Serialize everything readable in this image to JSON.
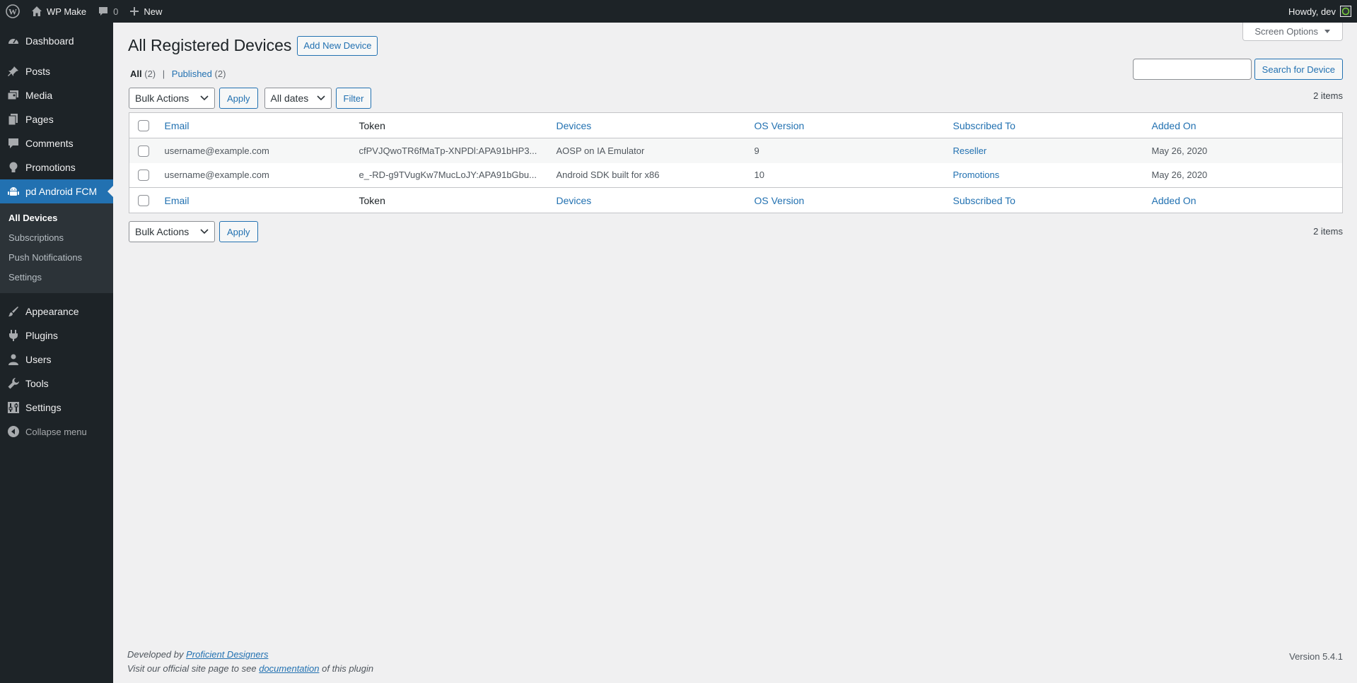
{
  "adminbar": {
    "site_name": "WP Make",
    "comments_count": "0",
    "new_label": "New",
    "howdy": "Howdy, dev"
  },
  "menu": {
    "dashboard": "Dashboard",
    "posts": "Posts",
    "media": "Media",
    "pages": "Pages",
    "comments": "Comments",
    "promotions": "Promotions",
    "pd_android_fcm": "pd Android FCM",
    "submenu": [
      "All Devices",
      "Subscriptions",
      "Push Notifications",
      "Settings"
    ],
    "appearance": "Appearance",
    "plugins": "Plugins",
    "users": "Users",
    "tools": "Tools",
    "settings": "Settings",
    "collapse": "Collapse menu"
  },
  "page": {
    "title": "All Registered Devices",
    "add_new": "Add New Device",
    "screen_options": "Screen Options",
    "views": {
      "all": "All",
      "all_count": "(2)",
      "published": "Published",
      "published_count": "(2)"
    },
    "search_button": "Search for Device",
    "search_value": "",
    "bulk_actions": "Bulk Actions",
    "apply": "Apply",
    "all_dates": "All dates",
    "filter": "Filter",
    "items_count": "2 items"
  },
  "table": {
    "columns": [
      "Email",
      "Token",
      "Devices",
      "OS Version",
      "Subscribed To",
      "Added On"
    ],
    "rows": [
      {
        "email": "username@example.com",
        "token": "cfPVJQwoTR6fMaTp-XNPDl:APA91bHP3...",
        "device": "AOSP on IA Emulator",
        "os": "9",
        "subscribed": "Reseller",
        "added": "May 26, 2020"
      },
      {
        "email": "username@example.com",
        "token": "e_-RD-g9TVugKw7MucLoJY:APA91bGbu...",
        "device": "Android SDK built for x86",
        "os": "10",
        "subscribed": "Promotions",
        "added": "May 26, 2020"
      }
    ]
  },
  "footer": {
    "developed_by": "Developed by",
    "company": "Proficient Designers",
    "visit_text": "Visit our official site page to see",
    "documentation": "documentation",
    "of_plugin": "of this plugin",
    "version": "Version 5.4.1"
  },
  "colors": {
    "accent": "#2271b1",
    "menu_bg": "#1d2327",
    "page_bg": "#f0f0f1"
  }
}
